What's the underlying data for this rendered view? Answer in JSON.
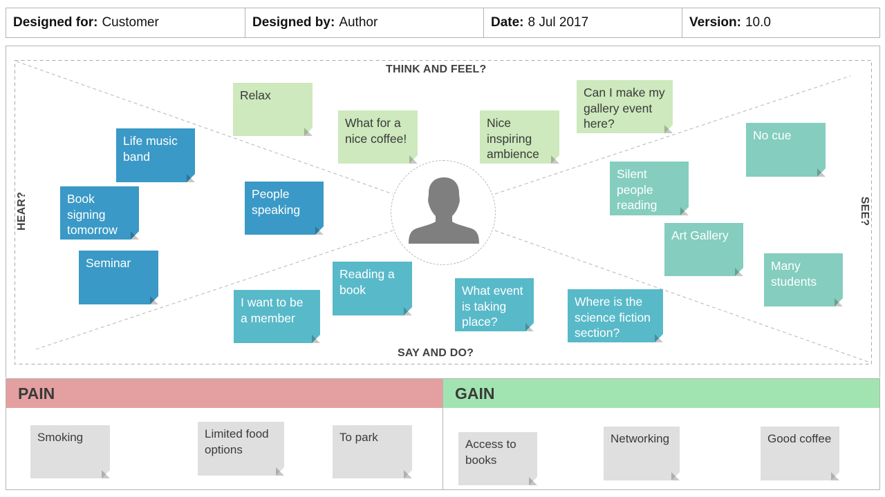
{
  "header": {
    "designed_for": {
      "label": "Designed for:",
      "value": "Customer"
    },
    "designed_by": {
      "label": "Designed by:",
      "value": "Author"
    },
    "date": {
      "label": "Date:",
      "value": "8 Jul 2017"
    },
    "version": {
      "label": "Version:",
      "value": "10.0"
    }
  },
  "map": {
    "quadrants": {
      "think": "THINK AND FEEL?",
      "say": "SAY AND DO?",
      "hear": "HEAR?",
      "see": "SEE?"
    },
    "center_icon": "person-silhouette-icon",
    "colors": {
      "think": "#cde9bd",
      "hear": "#3a99c6",
      "say": "#58b9c9",
      "see": "#84cdbf",
      "neutral": "#dfdfdf"
    },
    "think_notes": [
      "Relax",
      "What for a nice coffee!",
      "Nice inspiring ambience",
      "Can I make my gallery event here?"
    ],
    "hear_notes": [
      "Life music band",
      "Book signing tomorrow",
      "People speaking",
      "Seminar"
    ],
    "say_notes": [
      "I want to be a member",
      "Reading a book",
      "What event is taking place?",
      "Where is the science fiction section?"
    ],
    "see_notes": [
      "No cue",
      "Silent people reading",
      "Art Gallery",
      "Many students"
    ]
  },
  "pain": {
    "title": "PAIN",
    "color": "#e4a0a0",
    "notes": [
      "Smoking",
      "Limited food options",
      "To park"
    ]
  },
  "gain": {
    "title": "GAIN",
    "color": "#a2e4b1",
    "notes": [
      "Access to books",
      "Networking",
      "Good coffee"
    ]
  }
}
